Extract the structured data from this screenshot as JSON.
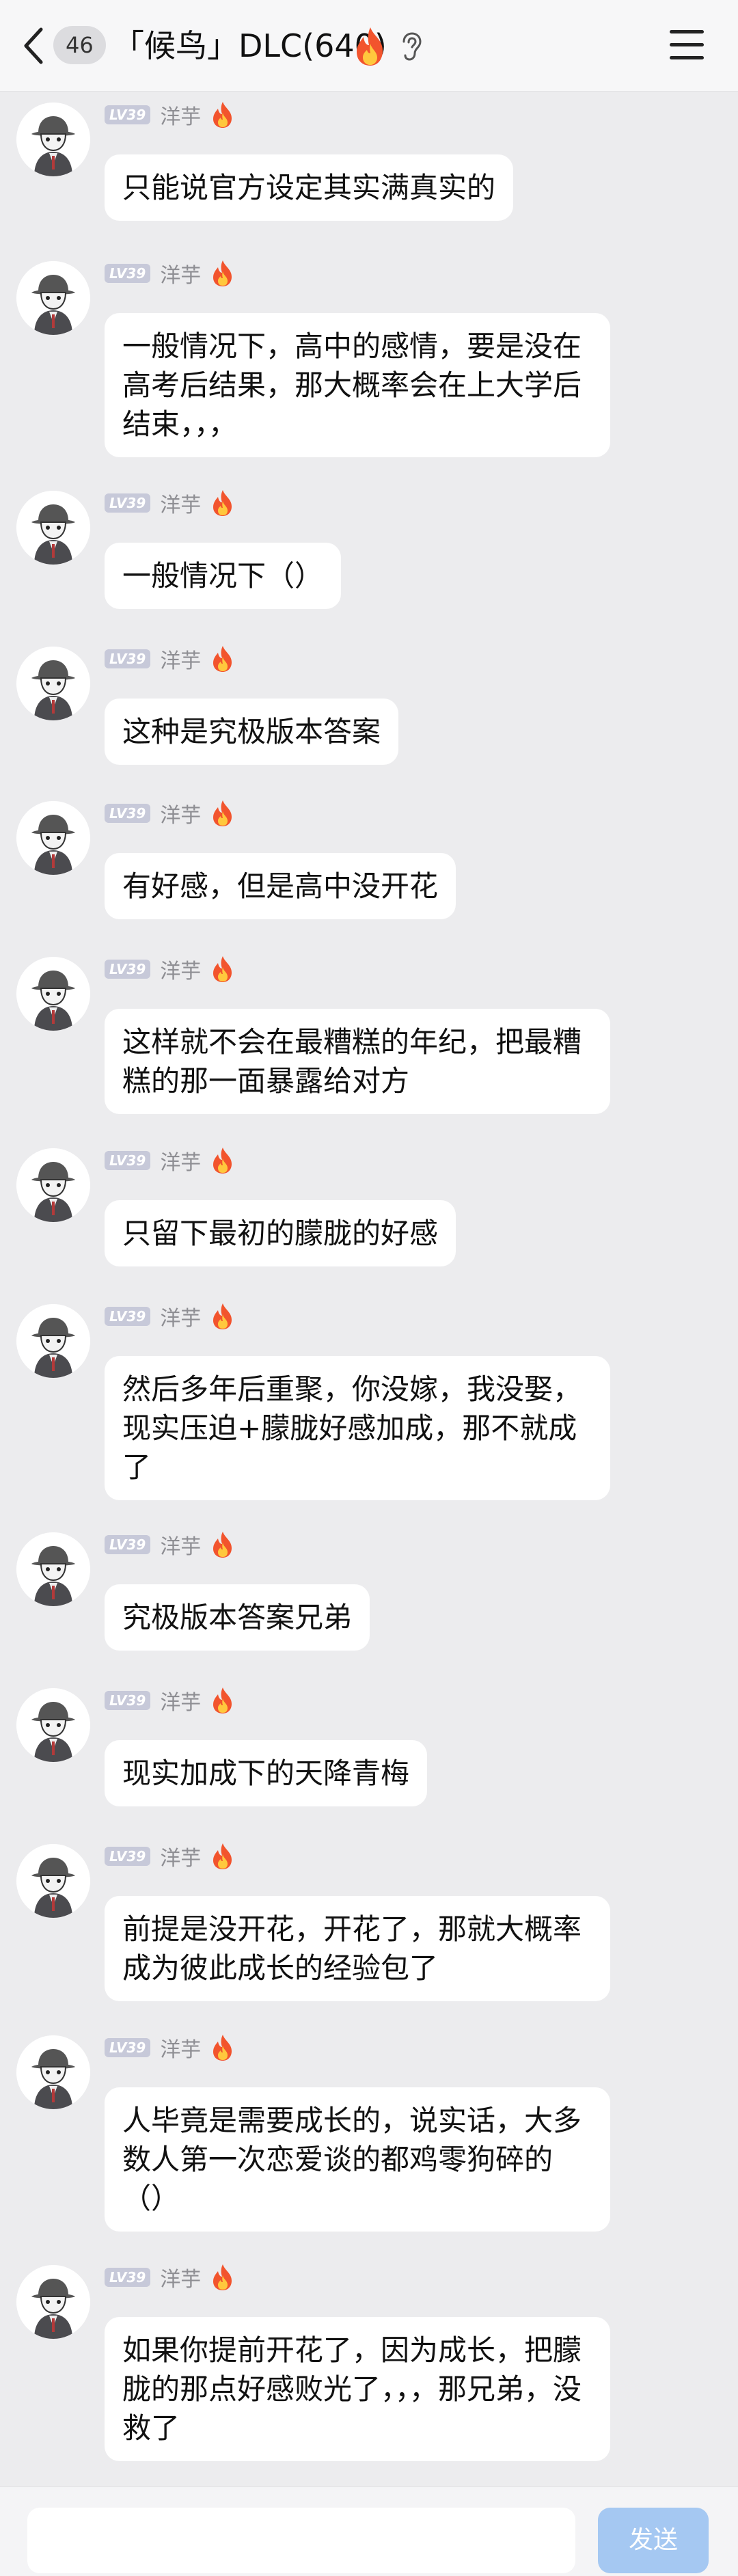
{
  "header": {
    "unread_count": "46",
    "title": "「候鸟」DLC(640)",
    "fire_icon": "fire-icon",
    "ear_icon": "ear-icon",
    "menu_icon": "hamburger-menu-icon"
  },
  "messages": [
    {
      "level": "LV39",
      "user": "洋芋",
      "text": "只能说官方设定其实满真实的"
    },
    {
      "level": "LV39",
      "user": "洋芋",
      "text": "一般情况下，高中的感情，要是没在高考后结果，那大概率会在上大学后结束，，，"
    },
    {
      "level": "LV39",
      "user": "洋芋",
      "text": "一般情况下（）"
    },
    {
      "level": "LV39",
      "user": "洋芋",
      "text": "这种是究极版本答案"
    },
    {
      "level": "LV39",
      "user": "洋芋",
      "text": "有好感，但是高中没开花"
    },
    {
      "level": "LV39",
      "user": "洋芋",
      "text": "这样就不会在最糟糕的年纪，把最糟糕的那一面暴露给对方"
    },
    {
      "level": "LV39",
      "user": "洋芋",
      "text": "只留下最初的朦胧的好感"
    },
    {
      "level": "LV39",
      "user": "洋芋",
      "text": "然后多年后重聚，你没嫁，我没娶，现实压迫+朦胧好感加成，那不就成了"
    },
    {
      "level": "LV39",
      "user": "洋芋",
      "text": "究极版本答案兄弟"
    },
    {
      "level": "LV39",
      "user": "洋芋",
      "text": "现实加成下的天降青梅"
    },
    {
      "level": "LV39",
      "user": "洋芋",
      "text": "前提是没开花，开花了，那就大概率成为彼此成长的经验包了"
    },
    {
      "level": "LV39",
      "user": "洋芋",
      "text": "人毕竟是需要成长的，说实话，大多数人第一次恋爱谈的都鸡零狗碎的（）"
    },
    {
      "level": "LV39",
      "user": "洋芋",
      "text": "如果你提前开花了，因为成长，把朦胧的那点好感败光了，，，那兄弟，没救了"
    }
  ],
  "footer": {
    "input_value": "",
    "send_label": "发送"
  },
  "colors": {
    "background": "#ececee",
    "bubble": "#ffffff",
    "level_badge": "#c7c9d9",
    "send_button": "#a5c8f2"
  }
}
